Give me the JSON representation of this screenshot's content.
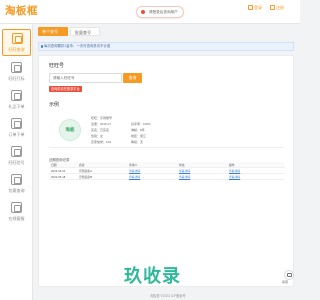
{
  "header": {
    "logo": "淘板框",
    "notice": "请登录后查询用户",
    "actions": [
      {
        "label": "登录",
        "icon": "user-icon"
      },
      {
        "label": "注册",
        "icon": "register-icon"
      }
    ]
  },
  "sidebar": {
    "items": [
      {
        "label": "旺旺查询",
        "icon": "search-doc-icon",
        "active": true
      },
      {
        "label": "旺旺打标",
        "icon": "tag-icon",
        "active": false
      },
      {
        "label": "礼品下单",
        "icon": "gift-icon",
        "active": false
      },
      {
        "label": "订单下单",
        "icon": "order-icon",
        "active": false
      },
      {
        "label": "旺旺验号",
        "icon": "verify-icon",
        "active": false
      },
      {
        "label": "包裹查询",
        "icon": "package-icon",
        "active": false
      },
      {
        "label": "在线客服",
        "icon": "service-icon",
        "active": false
      }
    ]
  },
  "tabs": [
    {
      "label": "单个查号"
    },
    {
      "label": "批量查号"
    }
  ],
  "tip": "每次查询需扣1金币，一天可查询多次不计费",
  "query": {
    "title": "旺旺号",
    "placeholder": "请输入旺旺号",
    "button": "查询",
    "hint": "查询前请先登录平台"
  },
  "result": {
    "title": "示例",
    "avatar_text": "淘板",
    "info": [
      "旺旺：示例账号",
      "注册：2015-07",
      "实名：已实名",
      "性别：女",
      "买家信誉：100",
      "好评率：100%",
      "淘龄：8年",
      "地区：浙江",
      "降权：无"
    ],
    "table": {
      "title": "近期查询记录",
      "headers": [
        "日期",
        "商家",
        "查询人",
        "状态",
        "操作"
      ],
      "rows": [
        [
          "2023-06-01",
          "示例商家A",
          "查看详情",
          "查看详情",
          "查看详情"
        ],
        [
          "2023-05-18",
          "示例商家B",
          "查看详情",
          "查看详情",
          "查看详情"
        ]
      ]
    }
  },
  "watermark": "玖收录",
  "float_button": {
    "label": "客服",
    "icon": "chat-icon"
  },
  "footer": "淘板框 ©2023 ICP备案号"
}
